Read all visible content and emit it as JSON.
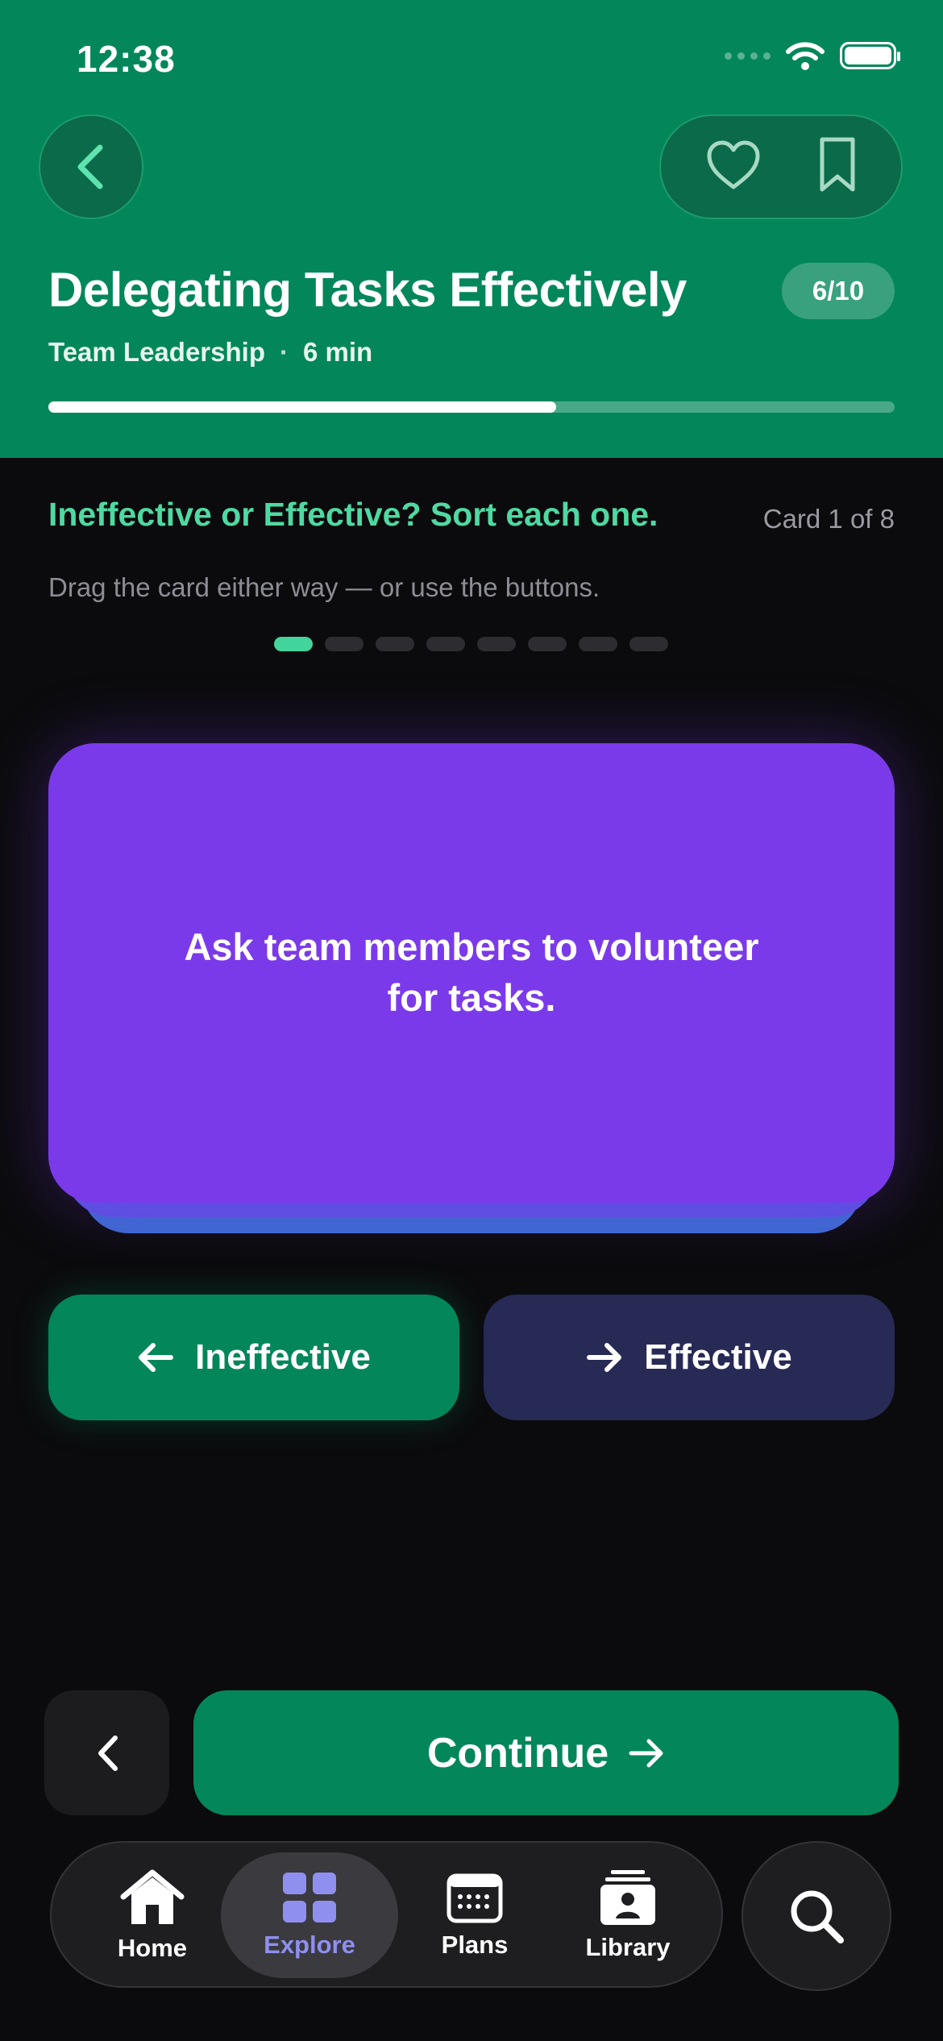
{
  "status_bar": {
    "time": "12:38"
  },
  "header": {
    "title": "Delegating Tasks Effectively",
    "category": "Team Leadership",
    "separator": "·",
    "duration": "6 min",
    "step_badge": "6/10",
    "progress_fraction": 0.6,
    "background": "#03875a"
  },
  "activity": {
    "prompt": "Ineffective or Effective? Sort each one.",
    "card_counter": "Card 1 of 8",
    "hint": "Drag the card either way — or use the buttons.",
    "total_cards": 8,
    "current_card": 1,
    "card_text": "Ask team members to volunteer for tasks.",
    "card_color": "#7b3aea",
    "left_button": "Ineffective",
    "right_button": "Effective"
  },
  "footer": {
    "continue_label": "Continue"
  },
  "tabbar": {
    "items": [
      {
        "label": "Home",
        "icon": "home-icon"
      },
      {
        "label": "Explore",
        "icon": "grid-icon",
        "active": true
      },
      {
        "label": "Plans",
        "icon": "calendar-icon"
      },
      {
        "label": "Library",
        "icon": "library-icon"
      }
    ],
    "search_icon": "search-icon",
    "accent": "#8f8ff0"
  }
}
